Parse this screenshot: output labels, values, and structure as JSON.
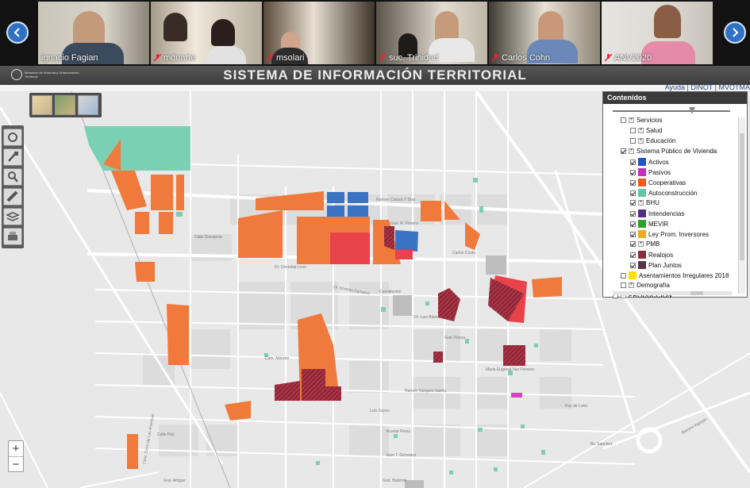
{
  "video_call": {
    "participants": [
      {
        "name": "ignacio Fagian",
        "muted": false
      },
      {
        "name": "mduarte",
        "muted": true
      },
      {
        "name": "msolari",
        "muted": true
      },
      {
        "name": "suc. Trinidad",
        "muted": true
      },
      {
        "name": "Carlos Cohn",
        "muted": true
      },
      {
        "name": "ANV2020",
        "muted": true
      }
    ],
    "prev_icon": "chevron-left-icon",
    "next_icon": "chevron-right-icon"
  },
  "app": {
    "title": "SISTEMA DE INFORMACIÓN TERRITORIAL",
    "logo_text": "Ministerio de Vivienda y Ordenamiento Territorial",
    "top_links": "Ayuda | DINOT | MVOTMA"
  },
  "toolbar": {
    "tools": [
      "measure-ring-icon",
      "pan-icon",
      "search-icon",
      "ruler-icon",
      "layers-icon",
      "print-icon"
    ]
  },
  "basemaps": [
    "basemap-topo-icon",
    "basemap-satellite-icon",
    "basemap-add-icon"
  ],
  "zoom": {
    "plus": "+",
    "minus": "−"
  },
  "contents": {
    "title": "Contenidos",
    "layers": [
      {
        "label": "Servicios",
        "checked": false,
        "expandable": true,
        "color": ""
      },
      {
        "label": "Salud",
        "checked": false,
        "expandable": true,
        "color": ""
      },
      {
        "label": "Educación",
        "checked": false,
        "expandable": true,
        "color": ""
      },
      {
        "label": "Sistema Público de Vivienda",
        "checked": true,
        "expandable": true,
        "color": ""
      },
      {
        "label": "Activos",
        "checked": true,
        "expandable": false,
        "color": "#1f55c4"
      },
      {
        "label": "Pasivos",
        "checked": true,
        "expandable": false,
        "color": "#c22fb8"
      },
      {
        "label": "Cooperativas",
        "checked": true,
        "expandable": false,
        "color": "#ee5a1b"
      },
      {
        "label": "Autoconstrucción",
        "checked": true,
        "expandable": false,
        "color": "#5fc7a6"
      },
      {
        "label": "BHU",
        "checked": true,
        "expandable": true,
        "color": ""
      },
      {
        "label": "Intendencias",
        "checked": true,
        "expandable": false,
        "color": "#532e86"
      },
      {
        "label": "MEVIR",
        "checked": true,
        "expandable": false,
        "color": "#2ba32b"
      },
      {
        "label": "Ley Prom. Inversores",
        "checked": true,
        "expandable": false,
        "color": "#f0a91c"
      },
      {
        "label": "PMB",
        "checked": true,
        "expandable": true,
        "color": ""
      },
      {
        "label": "Realojos",
        "checked": true,
        "expandable": false,
        "color": "#8c2d3c"
      },
      {
        "label": "Plan Juntos",
        "checked": true,
        "expandable": false,
        "color": "#5a3349"
      },
      {
        "label": "Asentamientos Irregulares 2018",
        "checked": false,
        "expandable": false,
        "color": "#ffe000"
      },
      {
        "label": "Demografía",
        "checked": false,
        "expandable": true,
        "color": ""
      },
      {
        "label": "PRODUCCION",
        "checked": false,
        "expandable": true,
        "color": ""
      }
    ]
  },
  "map": {
    "street_labels": [
      "Ramon Caraza Y Diaz",
      "Gral. R. Pereira",
      "Dr. Ernesto Carrasco",
      "Dr. Cristobal Leon",
      "Calle Discepolo",
      "Constitución",
      "Carlos Costa",
      "Dr. Luis Blanco",
      "Cam. Moreno",
      "Gral. Flores",
      "Ramon Vazquez Varela",
      "Maria Eugenia Vaz Ferreira",
      "Luis Sayon",
      "Paz de Lotoi",
      "Bv. Sanchez",
      "Juan T. Gonzalez",
      "Calle Paz",
      "Cont. Cerro de Las Americas",
      "Vicente Perez",
      "Gral. Bulonde",
      "Gral. Artigas",
      "Barrera Irigoyen"
    ],
    "fill_colors": {
      "cooperativas": "#f07a3c",
      "activos": "#3a72c4",
      "autoconstruccion": "#7ad0b3",
      "realojos": "#8c2d3c",
      "red_parcel": "#e8434b",
      "pasivos": "#d444c4",
      "gray_parcel": "#bdbdbd",
      "green_markers": "#7ecfb0"
    }
  }
}
